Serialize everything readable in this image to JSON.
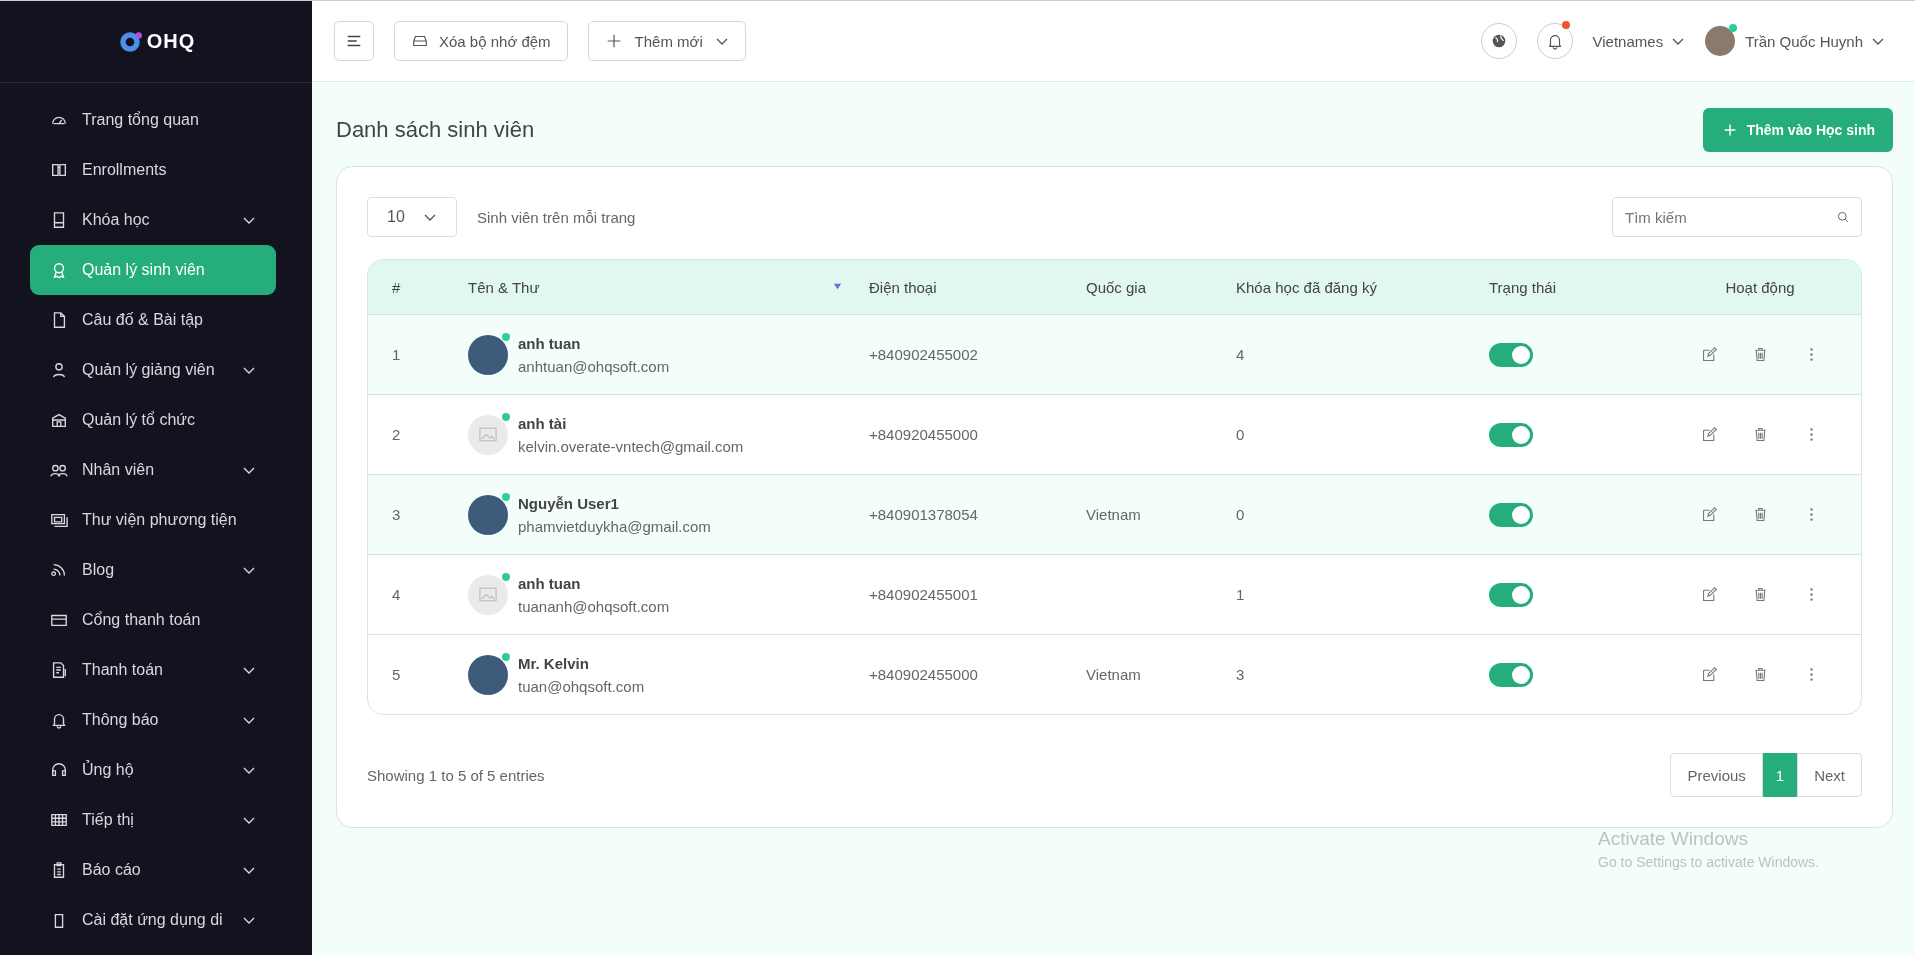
{
  "sidebar": {
    "logo": "OHQ",
    "items": [
      {
        "label": "Trang tổng quan",
        "expandable": false,
        "selected": false
      },
      {
        "label": "Enrollments",
        "expandable": false,
        "selected": false
      },
      {
        "label": "Khóa học",
        "expandable": true,
        "selected": false
      },
      {
        "label": "Quản lý sinh viên",
        "expandable": false,
        "selected": true
      },
      {
        "label": "Câu đố & Bài tập",
        "expandable": false,
        "selected": false
      },
      {
        "label": "Quản lý giảng viên",
        "expandable": true,
        "selected": false
      },
      {
        "label": "Quản lý tổ chức",
        "expandable": false,
        "selected": false
      },
      {
        "label": "Nhân viên",
        "expandable": true,
        "selected": false
      },
      {
        "label": "Thư viện phương tiện",
        "expandable": false,
        "selected": false
      },
      {
        "label": "Blog",
        "expandable": true,
        "selected": false
      },
      {
        "label": "Cổng thanh toán",
        "expandable": false,
        "selected": false
      },
      {
        "label": "Thanh toán",
        "expandable": true,
        "selected": false
      },
      {
        "label": "Thông báo",
        "expandable": true,
        "selected": false
      },
      {
        "label": "Ủng hộ",
        "expandable": true,
        "selected": false
      },
      {
        "label": "Tiếp thị",
        "expandable": true,
        "selected": false
      },
      {
        "label": "Báo cáo",
        "expandable": true,
        "selected": false
      },
      {
        "label": "Cài đặt ứng dụng di",
        "expandable": true,
        "selected": false
      }
    ]
  },
  "topbar": {
    "clear_cache": "Xóa bộ nhớ đệm",
    "add_new": "Thêm mới",
    "notification_badge": true,
    "language": "Vietnames",
    "user": "Trần Quốc Huynh",
    "user_online": true
  },
  "page": {
    "title": "Danh sách sinh viên",
    "add_button": "Thêm vào Học sinh"
  },
  "list_controls": {
    "per_page": "10",
    "per_page_label": "Sinh viên trên mỗi trang",
    "search": {
      "placeholder": "Tìm kiếm"
    }
  },
  "table": {
    "columns": [
      "#",
      "Tên & Thư",
      "Điện thoại",
      "Quốc gia",
      "Khóa học đã đăng ký",
      "Trạng thái",
      "Hoạt động"
    ],
    "rows": [
      {
        "index": "1",
        "name": "anh tuan",
        "email": "anhtuan@ohqsoft.com",
        "kind": "photo",
        "online": true,
        "phone": "+840902455002",
        "country": "",
        "courses": "4",
        "active": true,
        "highlighted": true
      },
      {
        "index": "2",
        "name": "anh tài",
        "email": "kelvin.overate-vntech@gmail.com",
        "kind": "placeholder",
        "online": true,
        "phone": "+840920455000",
        "country": "",
        "courses": "0",
        "active": true,
        "highlighted": false
      },
      {
        "index": "3",
        "name": "Nguyễn User1",
        "email": "phamvietduykha@gmail.com",
        "kind": "photo",
        "online": true,
        "phone": "+840901378054",
        "country": "Vietnam",
        "courses": "0",
        "active": true,
        "highlighted": true
      },
      {
        "index": "4",
        "name": "anh tuan",
        "email": "tuananh@ohqsoft.com",
        "kind": "placeholder",
        "online": true,
        "phone": "+840902455001",
        "country": "",
        "courses": "1",
        "active": true,
        "highlighted": false
      },
      {
        "index": "5",
        "name": "Mr. Kelvin",
        "email": "tuan@ohqsoft.com",
        "kind": "photo",
        "online": true,
        "phone": "+840902455000",
        "country": "Vietnam",
        "courses": "3",
        "active": true,
        "highlighted": false
      }
    ]
  },
  "footer": {
    "summary": "Showing 1 to 5 of 5 entries",
    "pagination": [
      {
        "label": "Previous",
        "kind": "nav",
        "selected": false
      },
      {
        "label": "1",
        "kind": "page",
        "selected": true
      },
      {
        "label": "Next",
        "kind": "nav",
        "selected": false
      }
    ]
  },
  "os_notice": {
    "title": "Activate Windows",
    "subtitle": "Go to Settings to activate Windows."
  }
}
